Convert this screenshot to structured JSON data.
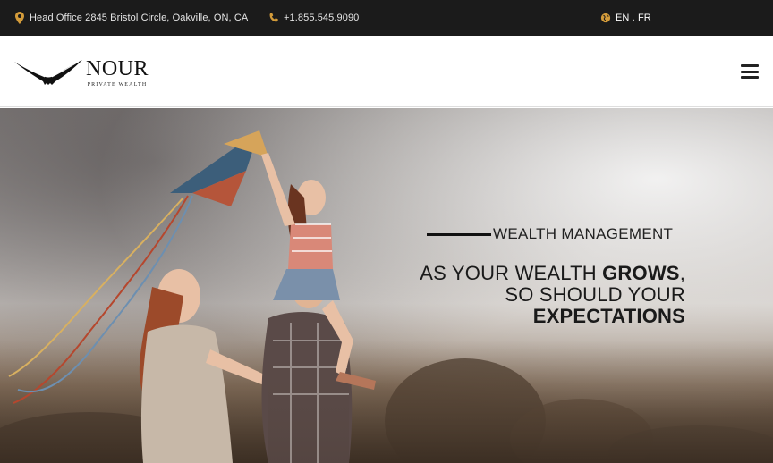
{
  "topbar": {
    "address": "Head Office 2845 Bristol Circle, Oakville, ON, CA",
    "phone": "+1.855.545.9090",
    "lang": "EN . FR"
  },
  "header": {
    "logo_name": "NOUR",
    "logo_sub": "PRIVATE WEALTH"
  },
  "hero": {
    "eyebrow": "WEALTH MANAGEMENT",
    "line1_thin": "AS YOUR WEALTH ",
    "line1_bold": "GROWS",
    "line1_end": ",",
    "line2": "SO SHOULD YOUR",
    "line3": "EXPECTATIONS"
  },
  "colors": {
    "topbar_bg": "#1b1b1b",
    "accent_icon": "#d39b3a",
    "text_dark": "#111111"
  }
}
